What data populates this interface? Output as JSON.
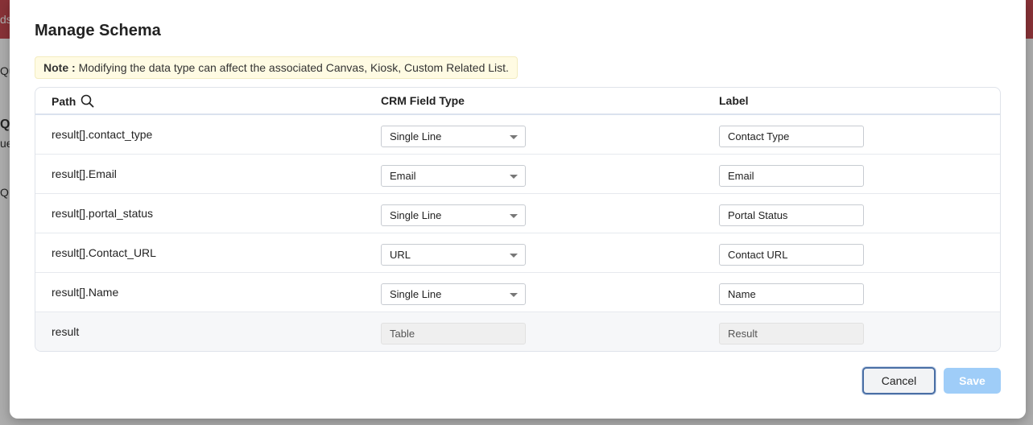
{
  "background": {
    "topbar_fragment": "ds",
    "fragments": [
      "Qu",
      "Qu",
      "ue",
      "Q"
    ]
  },
  "modal": {
    "title": "Manage Schema",
    "note": {
      "prefix": "Note :",
      "text": "Modifying the data type can affect the associated Canvas, Kiosk, Custom Related List."
    },
    "table": {
      "headers": {
        "path": "Path",
        "crm_field_type": "CRM Field Type",
        "label": "Label"
      },
      "rows": [
        {
          "path": "result[].contact_type",
          "field_type": "Single Line",
          "label": "Contact Type",
          "editable": true
        },
        {
          "path": "result[].Email",
          "field_type": "Email",
          "label": "Email",
          "editable": true
        },
        {
          "path": "result[].portal_status",
          "field_type": "Single Line",
          "label": "Portal Status",
          "editable": true
        },
        {
          "path": "result[].Contact_URL",
          "field_type": "URL",
          "label": "Contact URL",
          "editable": true
        },
        {
          "path": "result[].Name",
          "field_type": "Single Line",
          "label": "Name",
          "editable": true
        },
        {
          "path": "result",
          "field_type": "Table",
          "label": "Result",
          "editable": false
        }
      ]
    },
    "buttons": {
      "cancel": "Cancel",
      "save": "Save"
    }
  },
  "colors": {
    "accent": "#4a6fa5",
    "save_disabled": "#9fcdf8",
    "note_bg": "#fffbe3",
    "topbar": "#c94b52"
  },
  "icons": {
    "search": "search-icon",
    "dropdown": "chevron-down-icon"
  }
}
